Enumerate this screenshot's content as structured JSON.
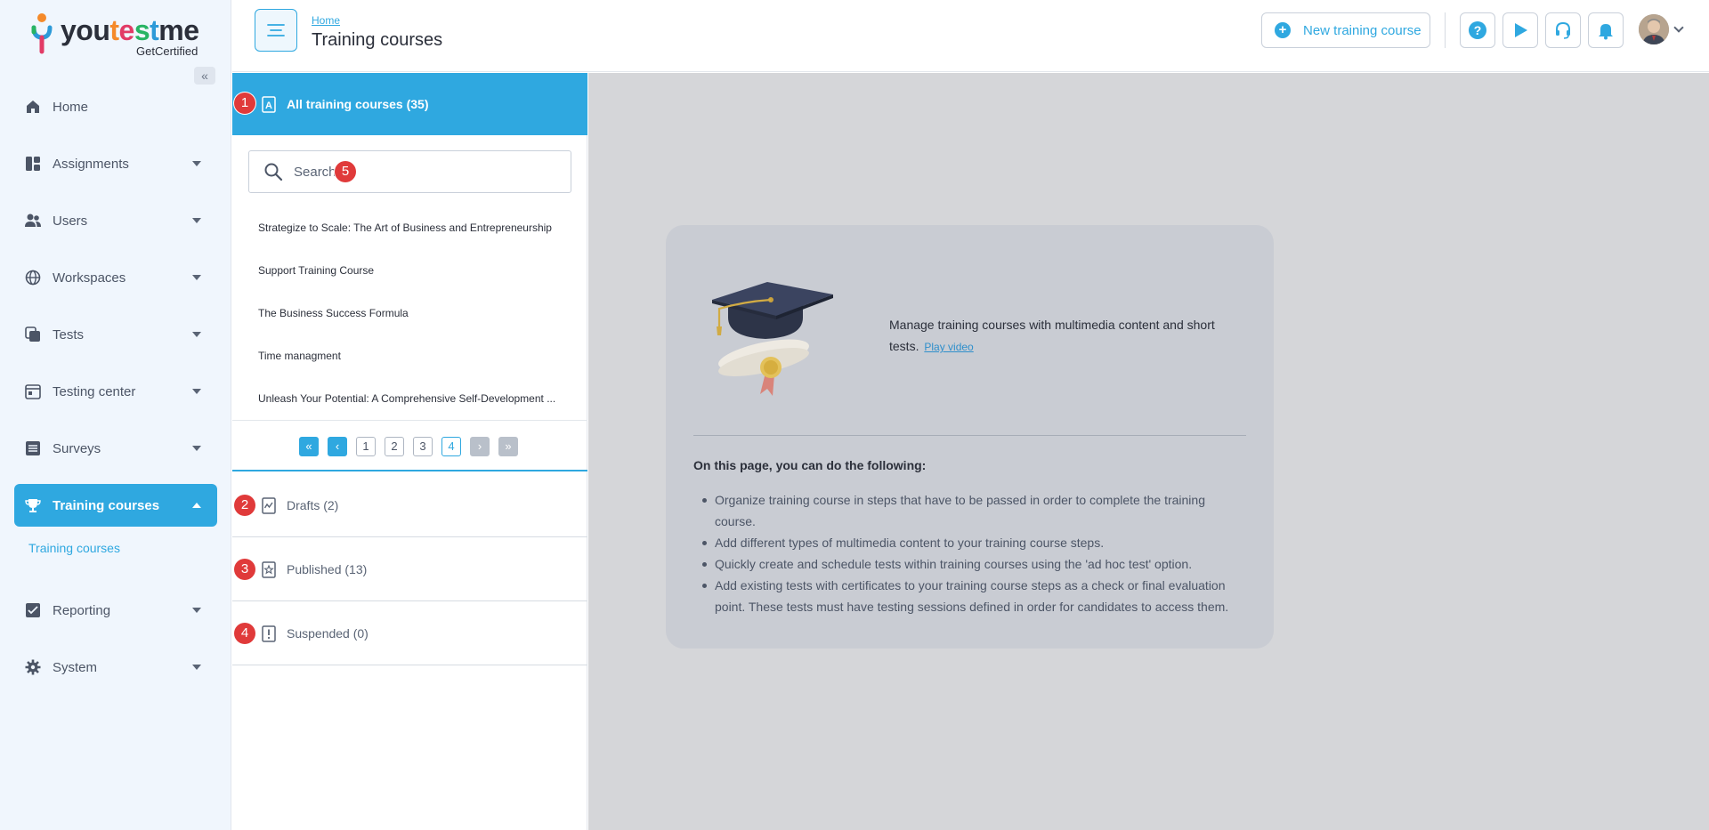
{
  "brand": {
    "name_parts": [
      "you",
      "t",
      "e",
      "s",
      "t",
      "me"
    ],
    "tagline": "GetCertified"
  },
  "sidebar": {
    "collapse_icon": "double-chevron-left-icon",
    "items": [
      {
        "label": "Home",
        "icon": "home-icon",
        "expandable": false
      },
      {
        "label": "Assignments",
        "icon": "assignments-icon",
        "expandable": true
      },
      {
        "label": "Users",
        "icon": "users-icon",
        "expandable": true
      },
      {
        "label": "Workspaces",
        "icon": "globe-icon",
        "expandable": true
      },
      {
        "label": "Tests",
        "icon": "tests-icon",
        "expandable": true
      },
      {
        "label": "Testing center",
        "icon": "calendar-icon",
        "expandable": true
      },
      {
        "label": "Surveys",
        "icon": "list-icon",
        "expandable": true
      },
      {
        "label": "Training courses",
        "icon": "trophy-icon",
        "expandable": true,
        "active": true
      },
      {
        "label": "Reporting",
        "icon": "report-icon",
        "expandable": true
      },
      {
        "label": "System",
        "icon": "gear-icon",
        "expandable": true
      }
    ],
    "sub_item": "Training courses"
  },
  "header": {
    "breadcrumb": "Home",
    "title": "Training courses",
    "new_button": "New training course",
    "icons": [
      "help-icon",
      "play-icon",
      "headset-icon",
      "bell-icon"
    ]
  },
  "panel": {
    "all_courses": {
      "label": "All training courses (35)",
      "badge": "1"
    },
    "search": {
      "placeholder": "Search",
      "badge": "5"
    },
    "courses": [
      "Strategize to Scale: The Art of Business and Entrepreneurship",
      "Support Training Course",
      "The Business Success Formula",
      "Time managment",
      "Unleash Your Potential: A Comprehensive Self-Development ..."
    ],
    "pagination": {
      "pages": [
        "1",
        "2",
        "3",
        "4"
      ],
      "current": "4"
    },
    "categories": [
      {
        "label": "Drafts (2)",
        "badge": "2",
        "icon": "drafts-icon"
      },
      {
        "label": "Published (13)",
        "badge": "3",
        "icon": "published-icon"
      },
      {
        "label": "Suspended (0)",
        "badge": "4",
        "icon": "suspended-icon"
      }
    ]
  },
  "content": {
    "intro": "Manage training courses with multimedia content and short tests.",
    "video_link": "Play video",
    "heading": "On this page, you can do the following:",
    "bullets": [
      "Organize training course in steps that have to be passed in order to complete the training course.",
      "Add different types of multimedia content to your training course steps.",
      "Quickly create and schedule tests within training courses using the 'ad hoc test' option.",
      "Add existing tests with certificates to your training course steps as a check or final evaluation point. These tests must have testing sessions defined in order for candidates to access them."
    ]
  },
  "colors": {
    "accent": "#2fa8e0",
    "badge": "#e03a3a",
    "sidebar_bg": "#f0f6fd"
  }
}
